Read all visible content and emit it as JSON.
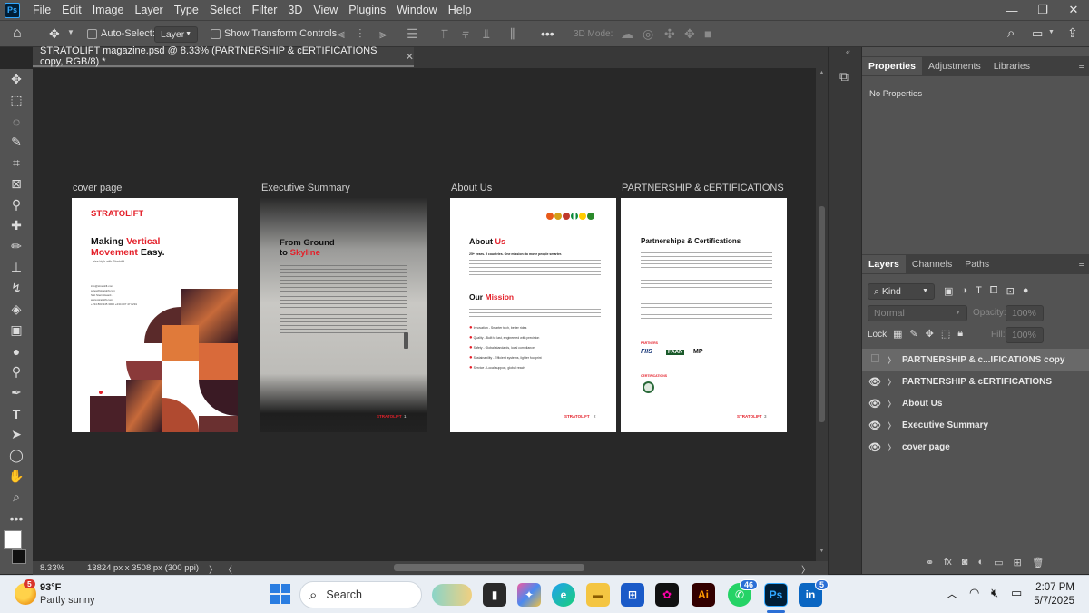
{
  "menu": {
    "logo": "Ps",
    "items": [
      "File",
      "Edit",
      "Image",
      "Layer",
      "Type",
      "Select",
      "Filter",
      "3D",
      "View",
      "Plugins",
      "Window",
      "Help"
    ]
  },
  "options": {
    "auto_select": "Auto-Select:",
    "layer_dd": "Layer",
    "transform": "Show Transform Controls",
    "mode3d": "3D Mode:"
  },
  "doc": {
    "tab": "STRATOLIFT magazine.psd @ 8.33% (PARTNERSHIP & cERTIFICATIONS copy, RGB/8) *",
    "zoom": "8.33%",
    "size": "13824 px x 3508 px (300 ppi)"
  },
  "artboards": {
    "cover": {
      "label": "cover page",
      "brand": "STRATOLIFT",
      "h1": "Making ",
      "h1_red": "Vertical",
      "h2_red": "Movement",
      "h2": " Easy.",
      "sub": "...rise high with Stratolift",
      "contacts": [
        "info@stratolift.com",
        "sales@stratolift.com",
        "Suit Stern Award...",
        "www.stratolift.com",
        "+234 803 345 3000 +234 807 47 8291"
      ]
    },
    "exec": {
      "label": "Executive Summary",
      "h1": "From Ground",
      "h2_pre": "to ",
      "h2_red": "Skyline",
      "brand": "STRATOLIFT",
      "page": "1"
    },
    "about": {
      "label": "About Us",
      "title": "About ",
      "title_red": "Us",
      "lead": "25+ years. 5 countries. One mission: to move people smarter.",
      "mission": "Our ",
      "mission_red": "Mission",
      "values": [
        "Innovation - Smarter tech, better rides",
        "Quality - Built to last, engineered with precision",
        "Safety - Global standards, local compliance",
        "Sustainability - Efficient systems, lighter footprint",
        "Service - Local support, global reach"
      ],
      "brand": "STRATOLIFT",
      "page": "2"
    },
    "partner": {
      "label": "PARTNERSHIP & cERTIFICATIONS",
      "title": "Partnerships & Certifications",
      "partners_label": "PARTNERS",
      "certs_label": "CERTIFICATIONS",
      "logos": [
        "FIIS",
        "FAAN",
        "MP"
      ],
      "brand": "STRATOLIFT",
      "page": "3"
    }
  },
  "panels": {
    "top_tabs": [
      "Properties",
      "Adjustments",
      "Libraries"
    ],
    "no_props": "No Properties",
    "layer_tabs": [
      "Layers",
      "Channels",
      "Paths"
    ],
    "kind": "Kind",
    "blend": "Normal",
    "opacity_label": "Opacity:",
    "opacity": "100%",
    "lock": "Lock:",
    "fill_label": "Fill:",
    "fill": "100%",
    "layers": [
      "PARTNERSHIP & c...IFICATIONS copy",
      "PARTNERSHIP & cERTIFICATIONS",
      "About Us",
      "Executive Summary",
      "cover page"
    ]
  },
  "taskbar": {
    "temp": "93°F",
    "weather": "Partly sunny",
    "weather_badge": "5",
    "search": "Search",
    "time": "2:07 PM",
    "date": "5/7/2025",
    "wa_badge": "46",
    "li_badge": "5"
  },
  "colors": {
    "accent_red": "#e4202a",
    "ps_blue": "#31a8ff"
  }
}
